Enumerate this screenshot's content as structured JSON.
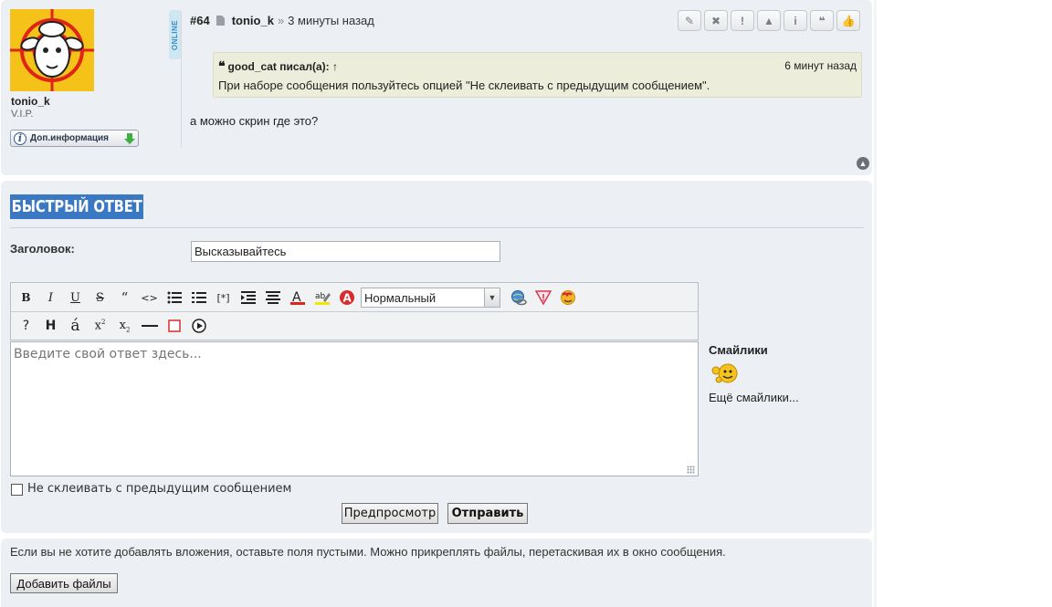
{
  "post": {
    "number": "#64",
    "author": "tonio_k",
    "separator": "»",
    "time": "3 минуты назад",
    "online_badge": "ONLINE",
    "user": {
      "name": "tonio_k",
      "rank": "V.I.P.",
      "more_info_label": "Доп.информация"
    },
    "actions": [
      {
        "name": "edit",
        "icon": "pencil-icon",
        "glyph": "✎"
      },
      {
        "name": "delete",
        "icon": "close-icon",
        "glyph": "✖"
      },
      {
        "name": "report",
        "icon": "exclamation-icon",
        "glyph": "!"
      },
      {
        "name": "warn",
        "icon": "warning-icon",
        "glyph": "▲"
      },
      {
        "name": "info",
        "icon": "info-icon",
        "glyph": "i"
      },
      {
        "name": "quote",
        "icon": "quote-icon",
        "glyph": "❝"
      },
      {
        "name": "like",
        "icon": "thumbs-up-icon",
        "glyph": "👍"
      }
    ],
    "quote": {
      "author_line": "good_cat писал(а):",
      "arrow": "↑",
      "time": "6 минут назад",
      "text": "При наборе сообщения пользуйтесь опцией \"Не склеивать с предыдущим сообщением\"."
    },
    "body": "а можно скрин где это?"
  },
  "reply": {
    "title": "БЫСТРЫЙ ОТВЕТ",
    "subject_label": "Заголовок:",
    "subject_value": "Высказывайтесь",
    "font_size_selected": "Нормальный",
    "editor_placeholder": "Введите свой ответ здесь...",
    "smilies_label": "Смайлики",
    "more_smilies": "Ещё смайлики...",
    "no_merge_label": "Не склеивать с предыдущим сообщением",
    "preview_label": "Предпросмотр",
    "send_label": "Отправить"
  },
  "attachments": {
    "hint": "Если вы не хотите добавлять вложения, оставьте поля пустыми. Можно прикреплять файлы, перетаскивая их в окно сообщения.",
    "add_files_label": "Добавить файлы"
  },
  "colors": {
    "panel_bg": "#eceff3",
    "title_bg": "#3a78c3",
    "quote_bg": "#eceedb",
    "avatar_bg": "#f5c21a",
    "online_color": "#3a8fc2"
  }
}
